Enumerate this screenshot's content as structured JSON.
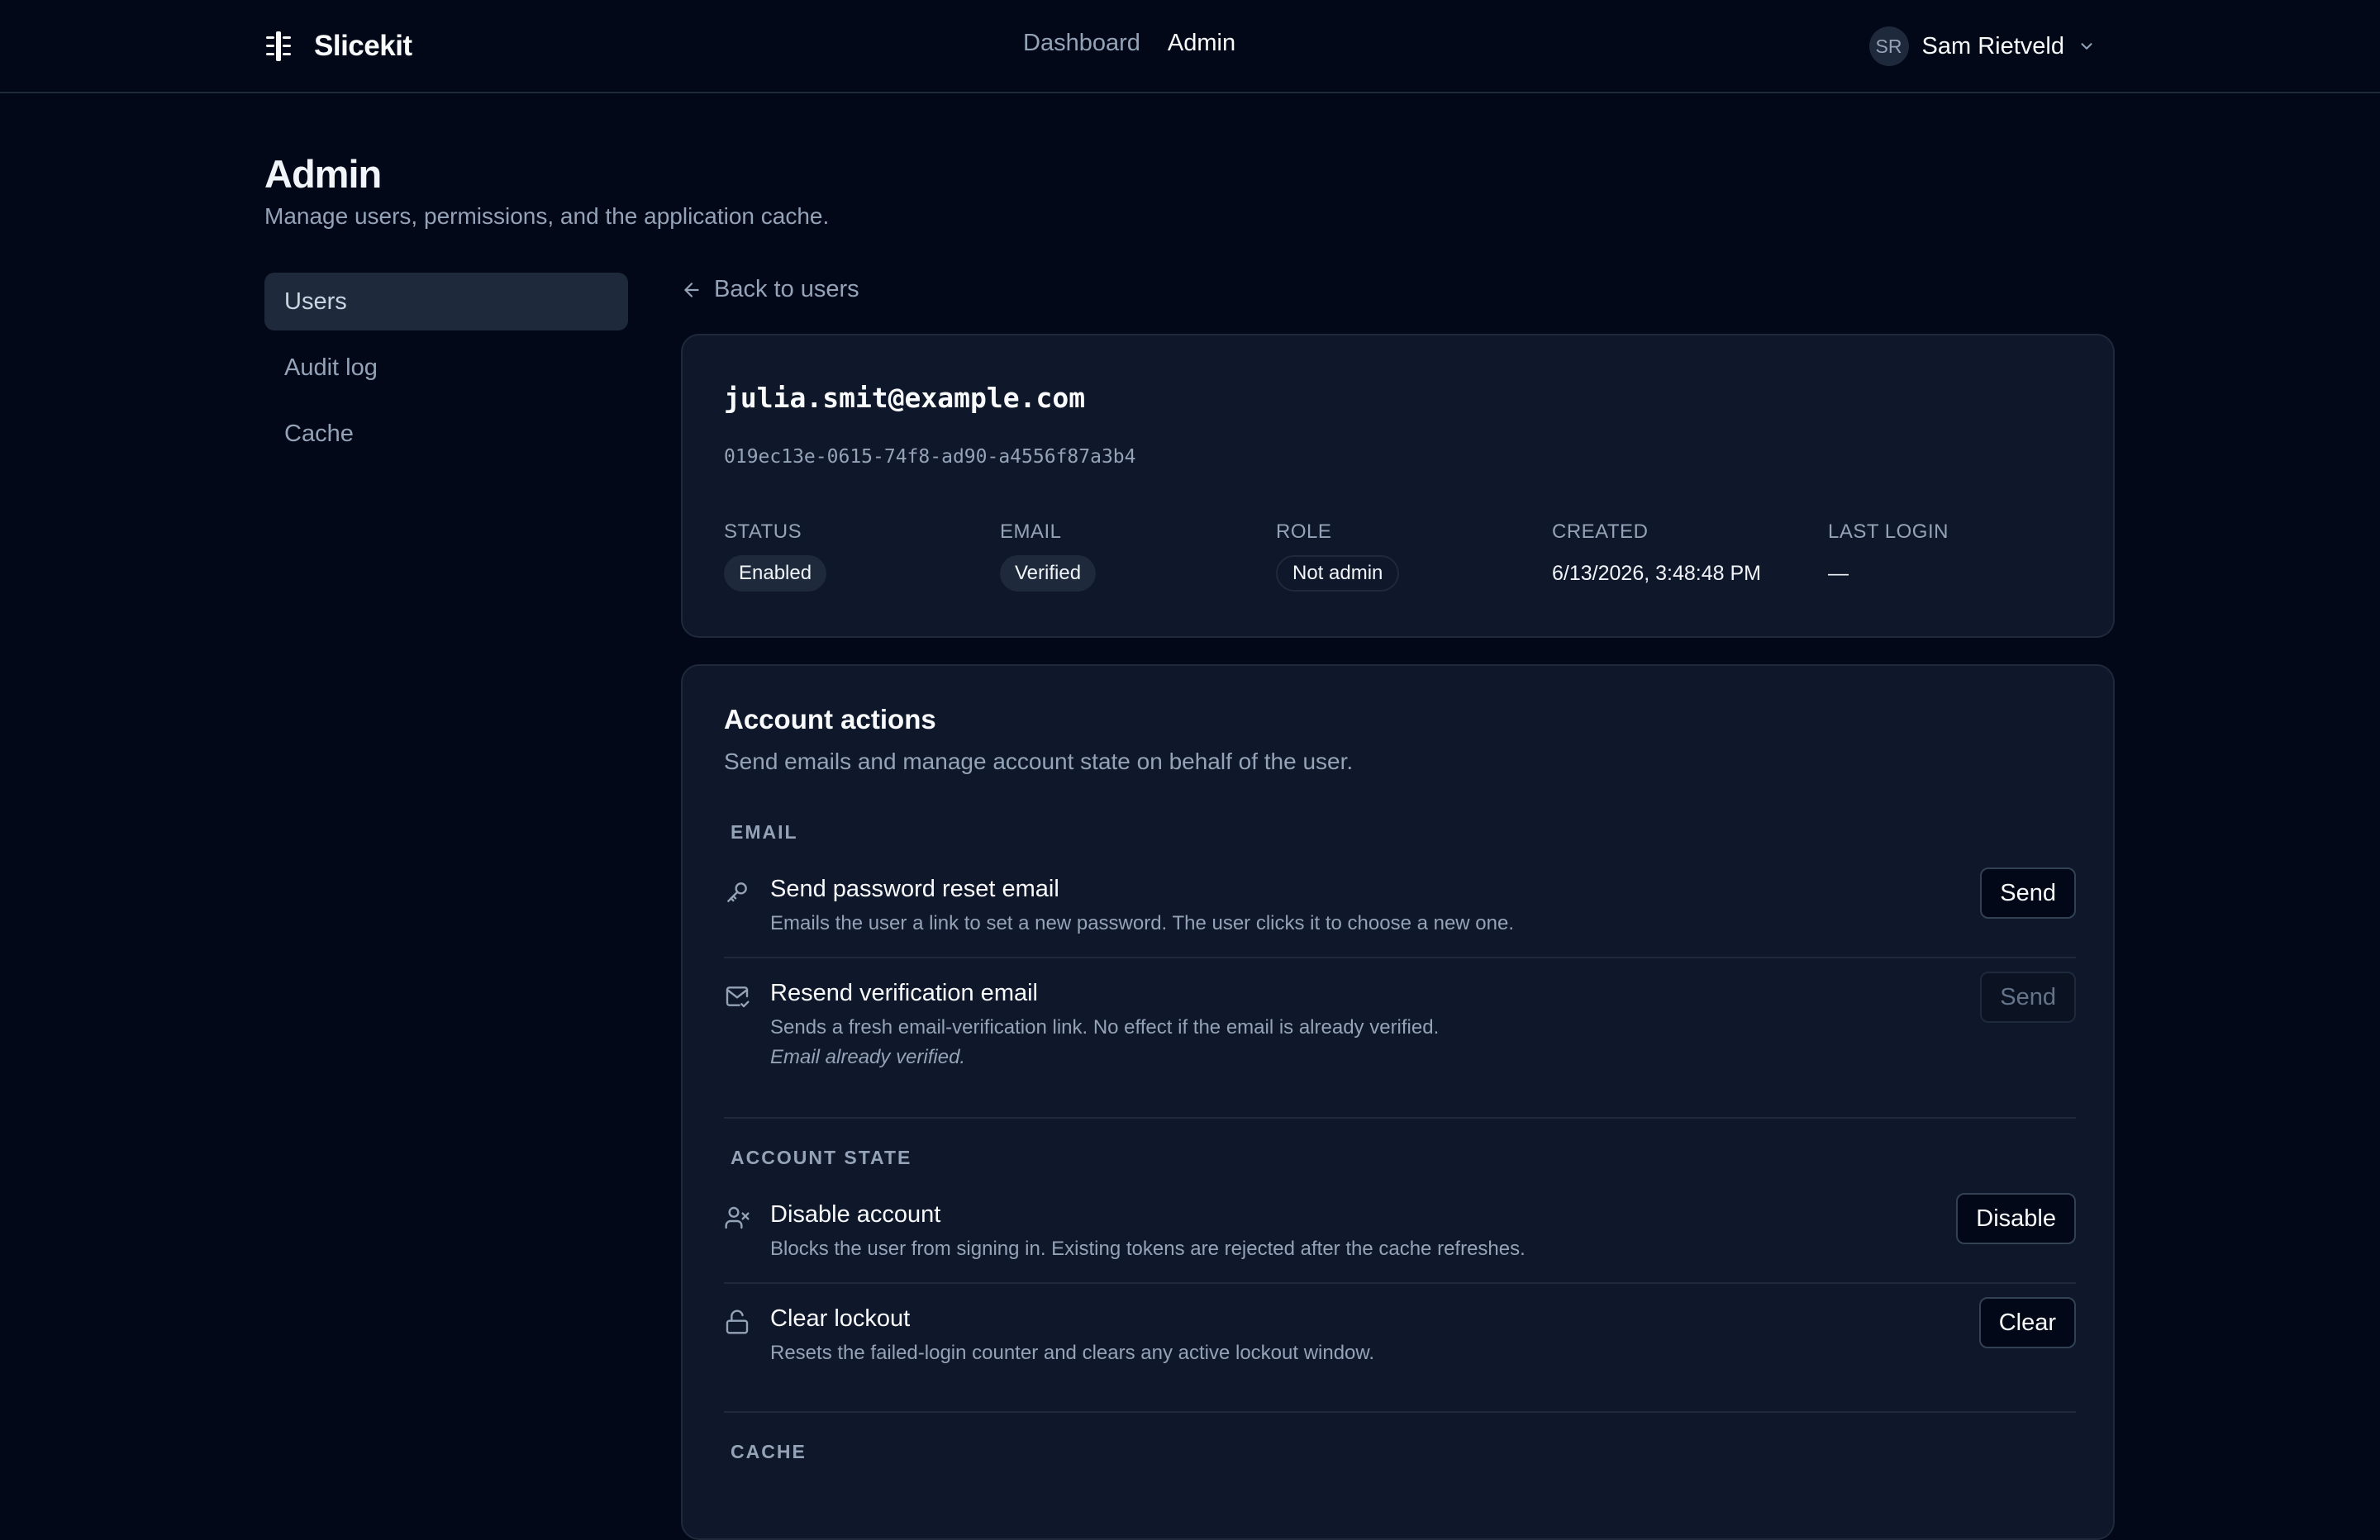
{
  "header": {
    "brand": "Slicekit",
    "nav": [
      {
        "label": "Dashboard",
        "active": false
      },
      {
        "label": "Admin",
        "active": true
      }
    ],
    "user": {
      "initials": "SR",
      "name": "Sam Rietveld"
    }
  },
  "page": {
    "title": "Admin",
    "subtitle": "Manage users, permissions, and the application cache."
  },
  "sidebar": {
    "items": [
      {
        "label": "Users",
        "active": true
      },
      {
        "label": "Audit log",
        "active": false
      },
      {
        "label": "Cache",
        "active": false
      }
    ]
  },
  "back_link": "Back to users",
  "user_card": {
    "email": "julia.smit@example.com",
    "id": "019ec13e-0615-74f8-ad90-a4556f87a3b4",
    "fields": [
      {
        "label": "STATUS",
        "value": "Enabled",
        "kind": "badge"
      },
      {
        "label": "EMAIL",
        "value": "Verified",
        "kind": "badge"
      },
      {
        "label": "ROLE",
        "value": "Not admin",
        "kind": "badge-outline"
      },
      {
        "label": "CREATED",
        "value": "6/13/2026, 3:48:48 PM",
        "kind": "text"
      },
      {
        "label": "LAST LOGIN",
        "value": "—",
        "kind": "text"
      }
    ]
  },
  "actions": {
    "title": "Account actions",
    "subtitle": "Send emails and manage account state on behalf of the user.",
    "groups": {
      "email": "EMAIL",
      "account_state": "ACCOUNT STATE",
      "cache": "CACHE"
    },
    "items": {
      "reset": {
        "icon": "key-icon",
        "title": "Send password reset email",
        "description": "Emails the user a link to set a new password. The user clicks it to choose a new one.",
        "button": "Send"
      },
      "verify": {
        "icon": "mail-check-icon",
        "title": "Resend verification email",
        "description": "Sends a fresh email-verification link. No effect if the email is already verified.",
        "note": "Email already verified.",
        "button": "Send",
        "button_disabled": true
      },
      "disable": {
        "icon": "user-x-icon",
        "title": "Disable account",
        "description": "Blocks the user from signing in. Existing tokens are rejected after the cache refreshes.",
        "button": "Disable"
      },
      "lockout": {
        "icon": "unlock-icon",
        "title": "Clear lockout",
        "description": "Resets the failed-login counter and clears any active lockout window.",
        "button": "Clear"
      }
    }
  }
}
